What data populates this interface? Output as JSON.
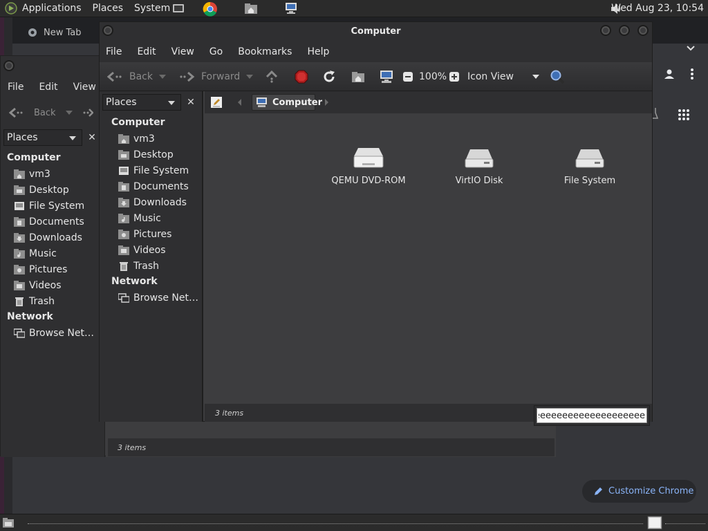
{
  "top_panel": {
    "menus": [
      "Applications",
      "Places",
      "System"
    ],
    "launchers": [
      "terminal-icon",
      "chrome-icon",
      "home-folder-icon",
      "computer-icon"
    ],
    "clock": "Wed Aug 23, 10:54"
  },
  "chrome": {
    "tab_title": "New Tab",
    "customize_label": "Customize Chrome",
    "accent": "#8ab4f8"
  },
  "back_window": {
    "menus": [
      "File",
      "Edit",
      "View"
    ],
    "toolbar": {
      "back": "Back"
    },
    "places_label": "Places",
    "computer_header": "Computer",
    "places": [
      "vm3",
      "Desktop",
      "File System",
      "Documents",
      "Downloads",
      "Music",
      "Pictures",
      "Videos",
      "Trash"
    ],
    "network_header": "Network",
    "network": [
      "Browse Net…"
    ],
    "status": "3 items"
  },
  "front_window": {
    "title": "Computer",
    "menus": [
      "File",
      "Edit",
      "View",
      "Go",
      "Bookmarks",
      "Help"
    ],
    "toolbar": {
      "back": "Back",
      "forward": "Forward",
      "zoom": "100%",
      "view_mode": "Icon View"
    },
    "places_label": "Places",
    "computer_header": "Computer",
    "places": [
      "vm3",
      "Desktop",
      "File System",
      "Documents",
      "Downloads",
      "Music",
      "Pictures",
      "Videos",
      "Trash"
    ],
    "network_header": "Network",
    "network": [
      "Browse Net…"
    ],
    "pathbar": {
      "current": "Computer"
    },
    "items": [
      {
        "label": "QEMU DVD-ROM",
        "icon": "optical-drive-icon"
      },
      {
        "label": "VirtIO Disk",
        "icon": "harddisk-icon"
      },
      {
        "label": "File System",
        "icon": "harddisk-icon"
      }
    ],
    "status": "3 items",
    "typeahead_value": "eeeeeeeeeeeeeeeeeeeeeeeeeeeeeee"
  }
}
